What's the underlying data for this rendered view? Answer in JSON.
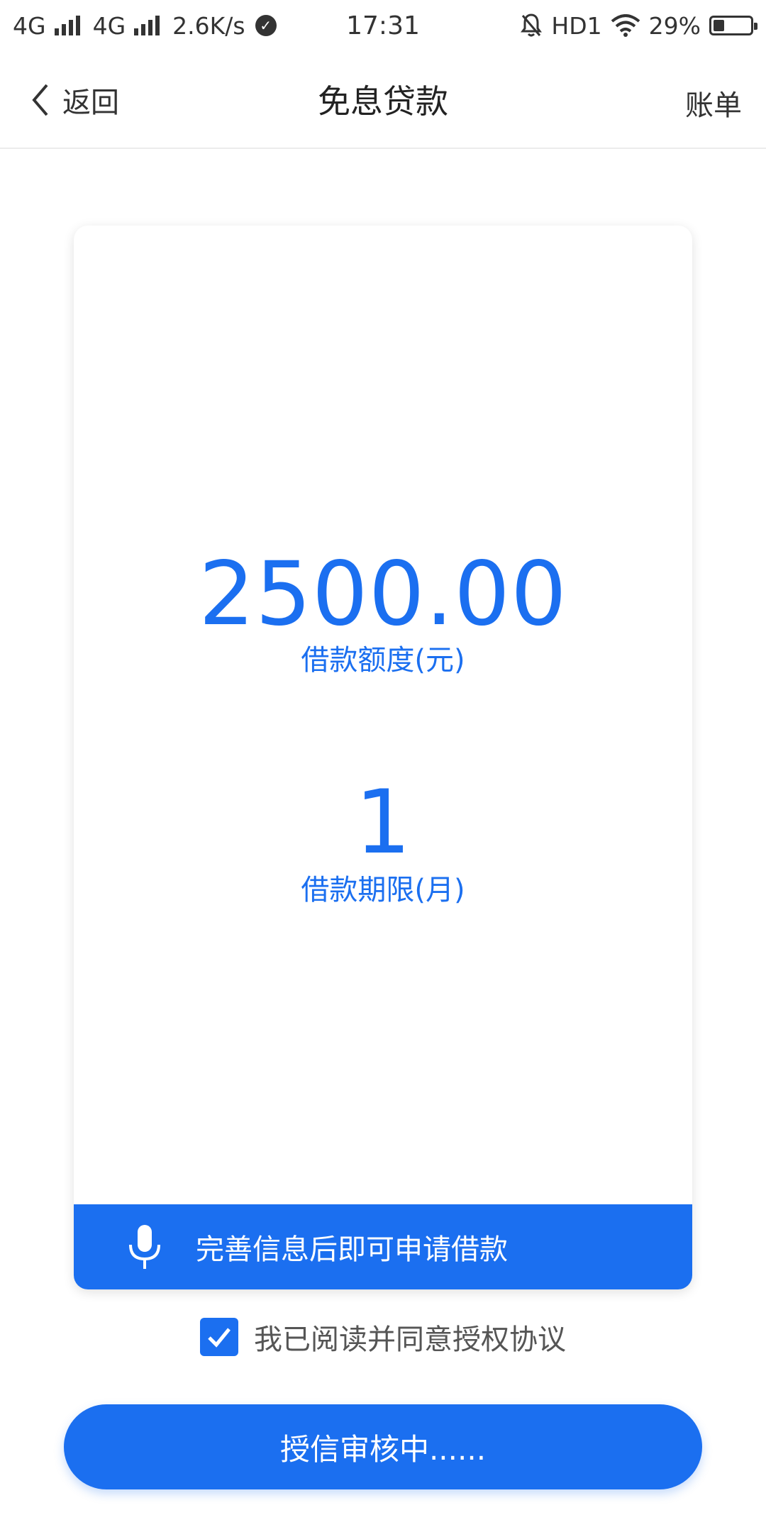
{
  "status_bar": {
    "net1": "4G",
    "net2": "4G",
    "speed": "2.6K/s",
    "time": "17:31",
    "hd": "HD1",
    "battery_text": "29%",
    "battery_level": 0.29
  },
  "nav": {
    "back_label": "返回",
    "title": "免息贷款",
    "right_label": "账单"
  },
  "loan": {
    "amount": "2500.00",
    "amount_label": "借款额度(元)",
    "term": "1",
    "term_label": "借款期限(月)"
  },
  "banner": {
    "text": "完善信息后即可申请借款",
    "icon": "microphone-icon"
  },
  "agreement": {
    "text": "我已阅读并同意授权协议",
    "checked": true
  },
  "main_button": {
    "label": "授信审核中......"
  },
  "colors": {
    "accent": "#1b6ff0"
  }
}
